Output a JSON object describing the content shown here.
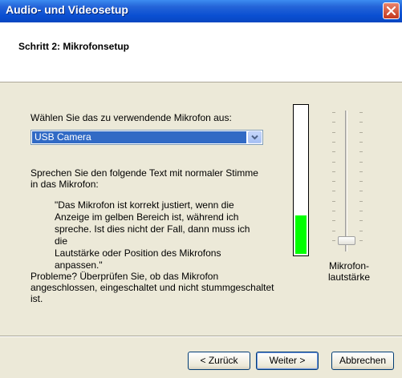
{
  "window": {
    "title": "Audio- und Videosetup",
    "close_icon": "close-icon"
  },
  "header": {
    "step_title": "Schritt 2: Mikrofonsetup"
  },
  "microphone": {
    "choose_label": "Wählen Sie das zu verwendende Mikrofon aus:",
    "selected": "USB Camera"
  },
  "instructions": {
    "line1": "Sprechen Sie den folgende Text mit normaler Stimme",
    "line2": "in das Mikrofon:",
    "quote_lines": [
      "\"Das Mikrofon ist korrekt justiert, wenn die",
      "Anzeige im gelben Bereich ist, während ich",
      "spreche. Ist dies nicht der Fall, dann muss ich die",
      "Lautstärke oder Position des Mikrofons",
      "anpassen.\""
    ]
  },
  "problems": {
    "line1": "Probleme? Überprüfen Sie, ob das Mikrofon",
    "line2": "angeschlossen, eingeschaltet und nicht stummgeschaltet",
    "line3": "ist."
  },
  "level_meter": {
    "level": 0.26,
    "color": "#00ff00"
  },
  "volume_slider": {
    "label_line1": "Mikrofon-",
    "label_line2": "lautstärke",
    "value": 0.08
  },
  "buttons": {
    "back": "< Zurück",
    "next": "Weiter >",
    "cancel": "Abbrechen"
  }
}
